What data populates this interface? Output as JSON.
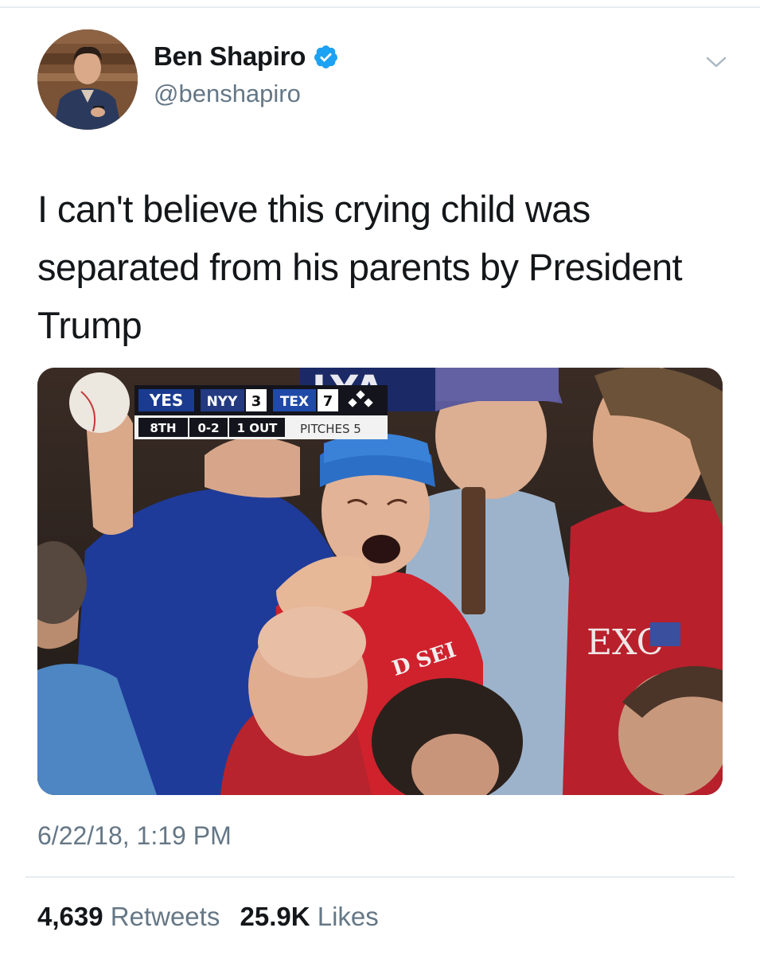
{
  "tweet": {
    "author": {
      "display_name": "Ben Shapiro",
      "handle": "@benshapiro",
      "verified": true,
      "avatar_icon": "profile-photo"
    },
    "text": "I can't believe this crying child was separated from his parents by President Trump",
    "timestamp": "6/22/18, 1:19 PM",
    "stats": {
      "retweets_count": "4,639",
      "retweets_label": "Retweets",
      "likes_count": "25.9K",
      "likes_label": "Likes"
    }
  },
  "media": {
    "scorebug": {
      "network": "YES",
      "team1": "NYY",
      "score1": "3",
      "team2": "TEX",
      "score2": "7",
      "inning": "8TH",
      "count": "0-2",
      "outs": "1 OUT",
      "pitches": "PITCHES 5"
    },
    "shirt_text": "D SEI"
  },
  "icons": {
    "verified": "verified-badge-icon",
    "caret": "chevron-down-icon"
  },
  "colors": {
    "verified_blue": "#1da1f2",
    "secondary_text": "#657786",
    "divider": "#e6ecf0"
  }
}
